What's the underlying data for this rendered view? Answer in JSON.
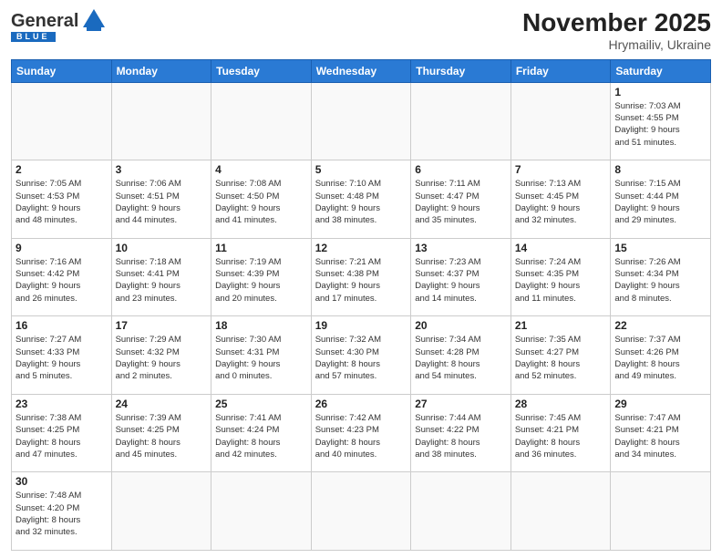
{
  "header": {
    "logo": {
      "general": "General",
      "blue": "Blue",
      "tagline": "BLUE"
    },
    "title": "November 2025",
    "subtitle": "Hrymailiv, Ukraine"
  },
  "weekdays": [
    "Sunday",
    "Monday",
    "Tuesday",
    "Wednesday",
    "Thursday",
    "Friday",
    "Saturday"
  ],
  "weeks": [
    [
      {
        "day": "",
        "info": ""
      },
      {
        "day": "",
        "info": ""
      },
      {
        "day": "",
        "info": ""
      },
      {
        "day": "",
        "info": ""
      },
      {
        "day": "",
        "info": ""
      },
      {
        "day": "",
        "info": ""
      },
      {
        "day": "1",
        "info": "Sunrise: 7:03 AM\nSunset: 4:55 PM\nDaylight: 9 hours\nand 51 minutes."
      }
    ],
    [
      {
        "day": "2",
        "info": "Sunrise: 7:05 AM\nSunset: 4:53 PM\nDaylight: 9 hours\nand 48 minutes."
      },
      {
        "day": "3",
        "info": "Sunrise: 7:06 AM\nSunset: 4:51 PM\nDaylight: 9 hours\nand 44 minutes."
      },
      {
        "day": "4",
        "info": "Sunrise: 7:08 AM\nSunset: 4:50 PM\nDaylight: 9 hours\nand 41 minutes."
      },
      {
        "day": "5",
        "info": "Sunrise: 7:10 AM\nSunset: 4:48 PM\nDaylight: 9 hours\nand 38 minutes."
      },
      {
        "day": "6",
        "info": "Sunrise: 7:11 AM\nSunset: 4:47 PM\nDaylight: 9 hours\nand 35 minutes."
      },
      {
        "day": "7",
        "info": "Sunrise: 7:13 AM\nSunset: 4:45 PM\nDaylight: 9 hours\nand 32 minutes."
      },
      {
        "day": "8",
        "info": "Sunrise: 7:15 AM\nSunset: 4:44 PM\nDaylight: 9 hours\nand 29 minutes."
      }
    ],
    [
      {
        "day": "9",
        "info": "Sunrise: 7:16 AM\nSunset: 4:42 PM\nDaylight: 9 hours\nand 26 minutes."
      },
      {
        "day": "10",
        "info": "Sunrise: 7:18 AM\nSunset: 4:41 PM\nDaylight: 9 hours\nand 23 minutes."
      },
      {
        "day": "11",
        "info": "Sunrise: 7:19 AM\nSunset: 4:39 PM\nDaylight: 9 hours\nand 20 minutes."
      },
      {
        "day": "12",
        "info": "Sunrise: 7:21 AM\nSunset: 4:38 PM\nDaylight: 9 hours\nand 17 minutes."
      },
      {
        "day": "13",
        "info": "Sunrise: 7:23 AM\nSunset: 4:37 PM\nDaylight: 9 hours\nand 14 minutes."
      },
      {
        "day": "14",
        "info": "Sunrise: 7:24 AM\nSunset: 4:35 PM\nDaylight: 9 hours\nand 11 minutes."
      },
      {
        "day": "15",
        "info": "Sunrise: 7:26 AM\nSunset: 4:34 PM\nDaylight: 9 hours\nand 8 minutes."
      }
    ],
    [
      {
        "day": "16",
        "info": "Sunrise: 7:27 AM\nSunset: 4:33 PM\nDaylight: 9 hours\nand 5 minutes."
      },
      {
        "day": "17",
        "info": "Sunrise: 7:29 AM\nSunset: 4:32 PM\nDaylight: 9 hours\nand 2 minutes."
      },
      {
        "day": "18",
        "info": "Sunrise: 7:30 AM\nSunset: 4:31 PM\nDaylight: 9 hours\nand 0 minutes."
      },
      {
        "day": "19",
        "info": "Sunrise: 7:32 AM\nSunset: 4:30 PM\nDaylight: 8 hours\nand 57 minutes."
      },
      {
        "day": "20",
        "info": "Sunrise: 7:34 AM\nSunset: 4:28 PM\nDaylight: 8 hours\nand 54 minutes."
      },
      {
        "day": "21",
        "info": "Sunrise: 7:35 AM\nSunset: 4:27 PM\nDaylight: 8 hours\nand 52 minutes."
      },
      {
        "day": "22",
        "info": "Sunrise: 7:37 AM\nSunset: 4:26 PM\nDaylight: 8 hours\nand 49 minutes."
      }
    ],
    [
      {
        "day": "23",
        "info": "Sunrise: 7:38 AM\nSunset: 4:25 PM\nDaylight: 8 hours\nand 47 minutes."
      },
      {
        "day": "24",
        "info": "Sunrise: 7:39 AM\nSunset: 4:25 PM\nDaylight: 8 hours\nand 45 minutes."
      },
      {
        "day": "25",
        "info": "Sunrise: 7:41 AM\nSunset: 4:24 PM\nDaylight: 8 hours\nand 42 minutes."
      },
      {
        "day": "26",
        "info": "Sunrise: 7:42 AM\nSunset: 4:23 PM\nDaylight: 8 hours\nand 40 minutes."
      },
      {
        "day": "27",
        "info": "Sunrise: 7:44 AM\nSunset: 4:22 PM\nDaylight: 8 hours\nand 38 minutes."
      },
      {
        "day": "28",
        "info": "Sunrise: 7:45 AM\nSunset: 4:21 PM\nDaylight: 8 hours\nand 36 minutes."
      },
      {
        "day": "29",
        "info": "Sunrise: 7:47 AM\nSunset: 4:21 PM\nDaylight: 8 hours\nand 34 minutes."
      }
    ],
    [
      {
        "day": "30",
        "info": "Sunrise: 7:48 AM\nSunset: 4:20 PM\nDaylight: 8 hours\nand 32 minutes."
      },
      {
        "day": "",
        "info": ""
      },
      {
        "day": "",
        "info": ""
      },
      {
        "day": "",
        "info": ""
      },
      {
        "day": "",
        "info": ""
      },
      {
        "day": "",
        "info": ""
      },
      {
        "day": "",
        "info": ""
      }
    ]
  ]
}
